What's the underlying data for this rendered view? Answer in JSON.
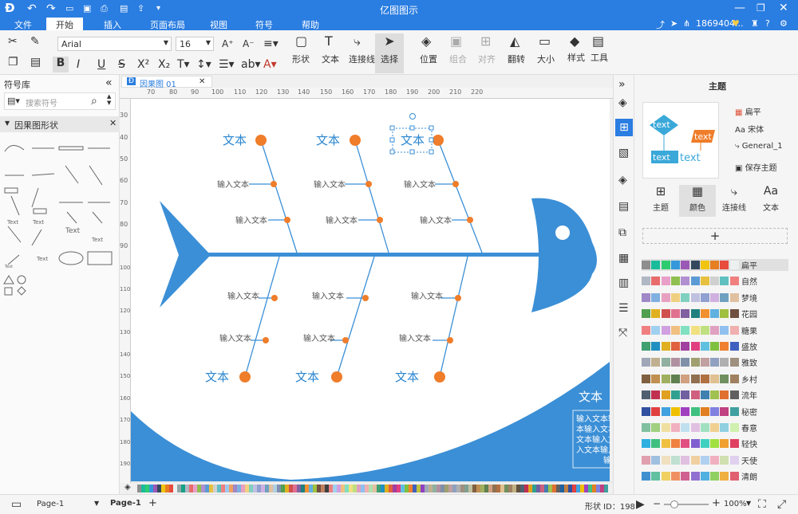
{
  "app": {
    "title": "亿图图示",
    "user": "1869404..."
  },
  "menu": {
    "items": [
      "文件",
      "开始",
      "插入",
      "页面布局",
      "视图",
      "符号",
      "帮助"
    ],
    "active": "开始"
  },
  "toolbar": {
    "font_name": "Arial",
    "font_size": "16",
    "labels": {
      "shape": "形状",
      "text": "文本",
      "connector": "连接线",
      "select": "选择",
      "position": "位置",
      "group": "组合",
      "align": "对齐",
      "flip": "翻转",
      "size": "大小",
      "style": "样式",
      "tools": "工具"
    }
  },
  "library": {
    "title": "符号库",
    "search_placeholder": "搜索符号",
    "section": "因果图形状",
    "shape_texts": [
      "Text",
      "Text",
      "Text",
      "Text",
      "Text",
      "Text"
    ]
  },
  "tab": {
    "name": "因果图 01"
  },
  "ruler": {
    "h": [
      "70",
      "80",
      "90",
      "100",
      "110",
      "120",
      "130",
      "140",
      "150",
      "160",
      "170",
      "180",
      "190",
      "200",
      "210",
      "220"
    ],
    "v": [
      "30",
      "40",
      "50",
      "60",
      "70",
      "80",
      "90",
      "100",
      "110",
      "120",
      "130",
      "140",
      "150",
      "160",
      "170",
      "180",
      "190"
    ]
  },
  "diagram": {
    "top_heads": [
      "文本",
      "文本",
      "文本"
    ],
    "bottom_heads": [
      "文本",
      "文本",
      "文本"
    ],
    "sub_labels": [
      "输入文本",
      "输入文本",
      "输入文本",
      "输入文本",
      "输入文本",
      "输入文本",
      "输入文本",
      "输入文本",
      "输入文本",
      "输入文本",
      "输入文本",
      "输入文本"
    ],
    "side_title": "文本",
    "side_body": [
      "输入文本输",
      "本输入文本",
      "文本输入文",
      "入文本输入",
      "输"
    ],
    "colors": {
      "fish": "#3b8fd6",
      "dot": "#ef7d2a",
      "line": "#3b8fd6",
      "text": "#2a86d0"
    }
  },
  "right_panel": {
    "title": "主题",
    "preview_texts": [
      "text",
      "text",
      "text",
      "text"
    ],
    "options": [
      "扁平",
      "宋体",
      "General_1",
      "保存主题"
    ],
    "tabs": [
      "主题",
      "颜色",
      "连接线",
      "文本"
    ],
    "active_tab": "颜色",
    "schemes": [
      {
        "name": "扁平",
        "colors": [
          "#8e8e8e",
          "#1abc9c",
          "#2ecc71",
          "#3498db",
          "#9b59b6",
          "#34495e",
          "#f1c40f",
          "#e67e22",
          "#e74c3c",
          "#ecf0f1",
          "#95a5a6",
          "#16a085"
        ]
      },
      {
        "name": "自然",
        "colors": [
          "#b0b8c4",
          "#e86c6c",
          "#e8a0c8",
          "#8fbf4f",
          "#b090d0",
          "#5b9bd5",
          "#e8c040",
          "#d0d0d0",
          "#60c0c0",
          "#f08080",
          "#a0c8f0",
          "#f0a060"
        ]
      },
      {
        "name": "梦境",
        "colors": [
          "#a088c8",
          "#80b0e0",
          "#e8a0c0",
          "#f0d080",
          "#80d0c0",
          "#c0c0e0",
          "#90a0d0",
          "#d0b0e0",
          "#70a0c0",
          "#e0c0a0",
          "#b0d0e0",
          "#8090b0"
        ]
      },
      {
        "name": "花园",
        "colors": [
          "#50a050",
          "#e0b020",
          "#d05050",
          "#e07090",
          "#8060a0",
          "#208080",
          "#f09030",
          "#60b0e0",
          "#a0c040",
          "#705040",
          "#c08060",
          "#404040"
        ]
      },
      {
        "name": "糖果",
        "colors": [
          "#f08080",
          "#a0d0f0",
          "#d0a0e0",
          "#f0c080",
          "#80e0c0",
          "#f0e080",
          "#c0e080",
          "#e0a0c0",
          "#90c0f0",
          "#f0b0b0",
          "#b0e0b0",
          "#e0c0a0"
        ]
      },
      {
        "name": "盛放",
        "colors": [
          "#40a070",
          "#2090c0",
          "#e0b020",
          "#e06040",
          "#a040a0",
          "#e04080",
          "#60c0e0",
          "#80c040",
          "#f08030",
          "#4060c0",
          "#c0c040",
          "#9040c0"
        ]
      },
      {
        "name": "雅致",
        "colors": [
          "#a0a8b8",
          "#c0b090",
          "#90b0a0",
          "#b090a0",
          "#8090a8",
          "#a0a070",
          "#c0a0a0",
          "#90a0c0",
          "#b0b0b0",
          "#a09080",
          "#80a090",
          "#c0c0a0"
        ]
      },
      {
        "name": "乡村",
        "colors": [
          "#806040",
          "#c09050",
          "#a0b060",
          "#608050",
          "#d0a080",
          "#907050",
          "#b07040",
          "#e0c090",
          "#709060",
          "#a08060",
          "#c0b080",
          "#605040"
        ]
      },
      {
        "name": "流年",
        "colors": [
          "#506070",
          "#c03050",
          "#e0a020",
          "#30a090",
          "#7060a0",
          "#d06080",
          "#4080b0",
          "#a0c050",
          "#e07030",
          "#606060",
          "#2060a0",
          "#c08040"
        ]
      },
      {
        "name": "秘密",
        "colors": [
          "#3050a0",
          "#e04040",
          "#40a0e0",
          "#f0c000",
          "#a040c0",
          "#40c080",
          "#e08020",
          "#8080e0",
          "#c04080",
          "#40a0a0",
          "#e0e060",
          "#604080"
        ]
      },
      {
        "name": "春意",
        "colors": [
          "#80c0a0",
          "#a0d080",
          "#f0e0a0",
          "#f0b0c0",
          "#c0e0f0",
          "#e0c0e0",
          "#a0e0c0",
          "#f0d090",
          "#90d0e0",
          "#d0f0b0",
          "#f0c0a0",
          "#b0c0f0"
        ]
      },
      {
        "name": "轻快",
        "colors": [
          "#30b0e0",
          "#40c080",
          "#f0c040",
          "#f08040",
          "#e05080",
          "#8060d0",
          "#40d0c0",
          "#a0e040",
          "#f0a030",
          "#e04060",
          "#6080e0",
          "#c0c0c0"
        ]
      },
      {
        "name": "天使",
        "colors": [
          "#e0a0b0",
          "#a0c0e0",
          "#f0e0c0",
          "#c0e0d0",
          "#e0c0e0",
          "#f0d0a0",
          "#b0d0f0",
          "#f0b0c0",
          "#d0e0b0",
          "#e0d0f0",
          "#c0c0d0",
          "#f0e0e0"
        ]
      },
      {
        "name": "清朗",
        "colors": [
          "#4090d0",
          "#60c0a0",
          "#f0d060",
          "#f09060",
          "#d06090",
          "#9070d0",
          "#50b0e0",
          "#90d060",
          "#f0b040",
          "#e06070",
          "#7090e0",
          "#b0b0b0"
        ]
      }
    ]
  },
  "status": {
    "page_selector": "Page-1",
    "page_tab": "Page-1",
    "shape_id": "形状 ID：198",
    "zoom": "100%"
  }
}
